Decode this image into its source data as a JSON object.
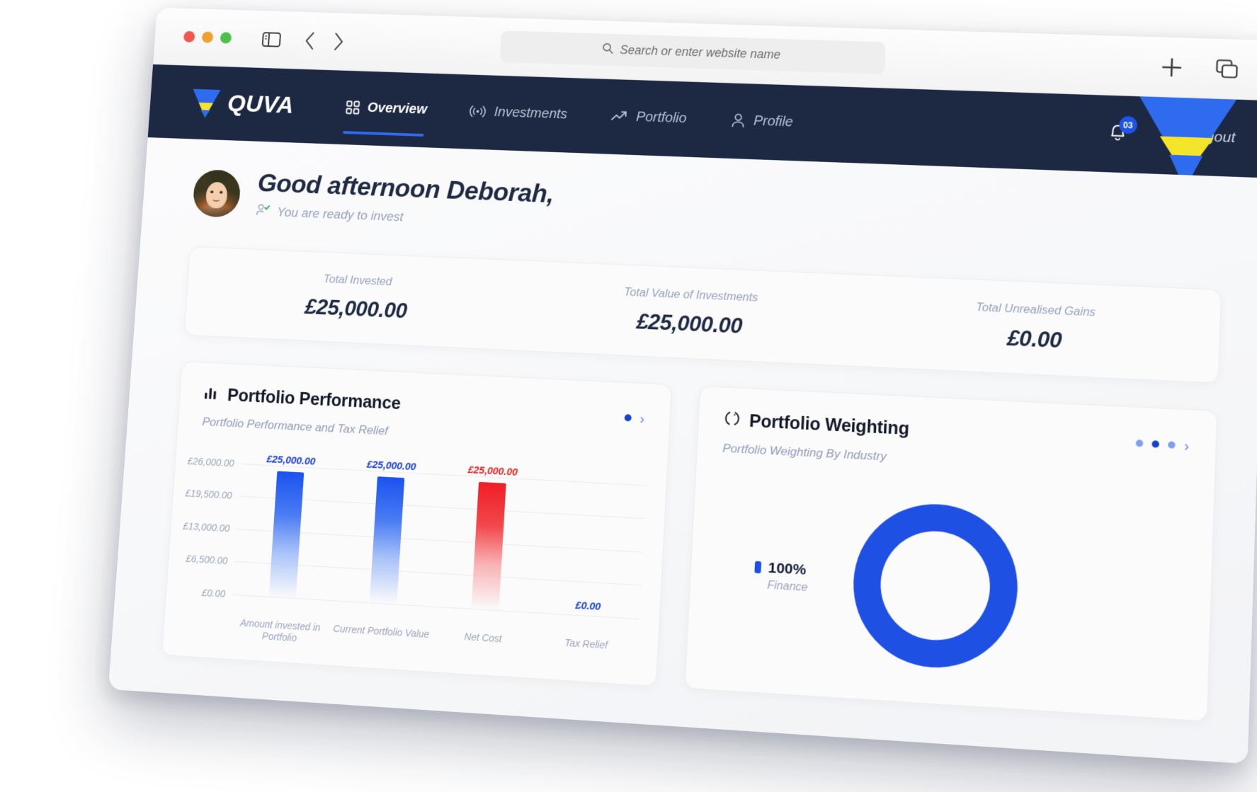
{
  "browser": {
    "search_placeholder": "Search or enter website name",
    "search_icon": "search-icon",
    "sidebar_icon": "sidebar-toggle-icon",
    "back_icon": "back-chevron-icon",
    "forward_icon": "forward-chevron-icon",
    "new_tab_icon": "plus-icon",
    "tab_overview_icon": "tab-overview-icon"
  },
  "nav": {
    "brand": "QUVA",
    "items": [
      {
        "label": "Overview",
        "icon": "grid-icon",
        "active": true
      },
      {
        "label": "Investments",
        "icon": "broadcast-icon",
        "active": false
      },
      {
        "label": "Portfolio",
        "icon": "trending-up-icon",
        "active": false
      },
      {
        "label": "Profile",
        "icon": "user-icon",
        "active": false
      }
    ],
    "notification_count": "03",
    "logout_label": "Logout",
    "bell_icon": "bell-icon",
    "logout_icon": "logout-icon",
    "accent_blue": "#1f55e6",
    "navy": "#1d2943",
    "brand_yellow": "#f5e52a"
  },
  "greeting": {
    "title": "Good afternoon Deborah,",
    "status": "You are ready to invest",
    "status_icon": "user-verified-icon",
    "avatar": "avatar"
  },
  "stats": [
    {
      "label": "Total Invested",
      "value": "£25,000.00"
    },
    {
      "label": "Total Value of Investments",
      "value": "£25,000.00"
    },
    {
      "label": "Total Unrealised Gains",
      "value": "£0.00"
    }
  ],
  "performance_card": {
    "title": "Portfolio Performance",
    "subtitle": "Portfolio Performance and Tax Relief",
    "icon": "bar-chart-icon",
    "dots": [
      {
        "active": true
      }
    ],
    "chevron": "›"
  },
  "weighting_card": {
    "title": "Portfolio Weighting",
    "subtitle": "Portfolio Weighting By Industry",
    "icon": "donut-chart-icon",
    "dots": [
      {
        "active": false
      },
      {
        "active": true
      },
      {
        "active": false
      }
    ],
    "chevron": "›"
  },
  "chart_data": [
    {
      "type": "bar",
      "title": "Portfolio Performance",
      "subtitle": "Portfolio Performance and Tax Relief",
      "categories": [
        "Amount invested in Portfolio",
        "Current Portfolio Value",
        "Net Cost",
        "Tax Relief"
      ],
      "values": [
        25000,
        25000,
        25000,
        0
      ],
      "value_labels": [
        "£25,000.00",
        "£25,000.00",
        "£25,000.00",
        "£0.00"
      ],
      "bar_colors": [
        "#1b52ef",
        "#1b52ef",
        "#ef1f25",
        "#1b52ef"
      ],
      "label_colors": [
        "#1740d6",
        "#1740d6",
        "#e8231f",
        "#1740d6"
      ],
      "ylim": [
        0,
        26000
      ],
      "yticks": [
        0,
        6500,
        13000,
        19500,
        26000
      ],
      "ytick_labels": [
        "£0.00",
        "£6,500.00",
        "£13,000.00",
        "£19,500.00",
        "£26,000.00"
      ],
      "xlabel": "",
      "ylabel": "",
      "grid": true,
      "legend": false
    },
    {
      "type": "pie",
      "title": "Portfolio Weighting",
      "subtitle": "Portfolio Weighting By Industry",
      "labels": [
        "Finance"
      ],
      "values": [
        100
      ],
      "value_labels": [
        "100%"
      ],
      "colors": [
        "#1f50e4"
      ],
      "donut": true,
      "legend": "left"
    }
  ]
}
